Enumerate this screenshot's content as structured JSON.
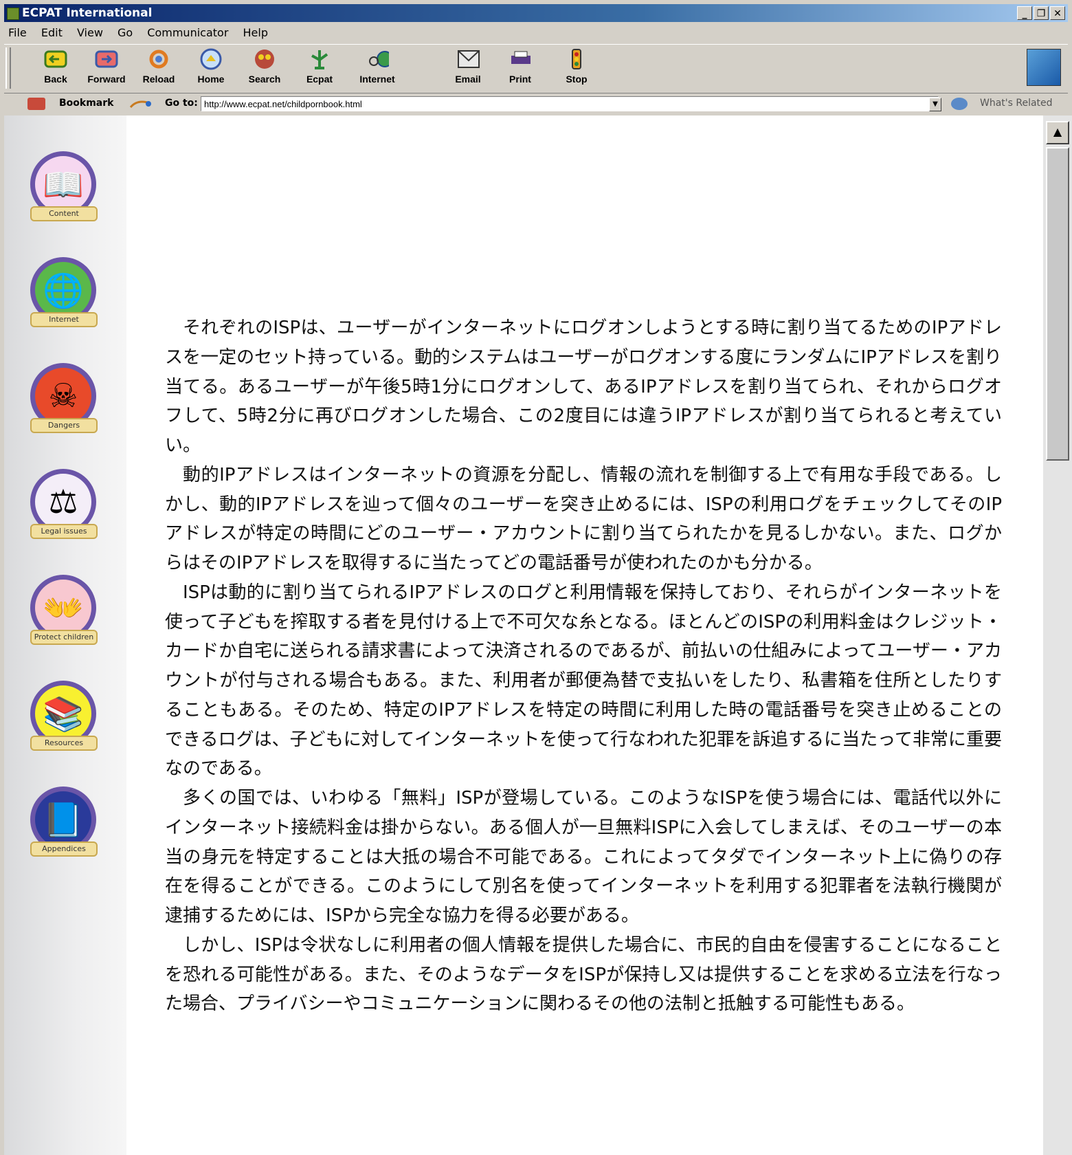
{
  "window": {
    "title": "ECPAT International",
    "controls": [
      "_",
      "❐",
      "✕"
    ]
  },
  "menu": [
    "File",
    "Edit",
    "View",
    "Go",
    "Communicator",
    "Help"
  ],
  "toolbar": {
    "buttons": [
      {
        "label": "Back",
        "icon": "back-arrow-icon"
      },
      {
        "label": "Forward",
        "icon": "forward-arrow-icon"
      },
      {
        "label": "Reload",
        "icon": "reload-icon"
      },
      {
        "label": "Home",
        "icon": "home-icon"
      },
      {
        "label": "Search",
        "icon": "search-icon"
      },
      {
        "label": "Ecpat",
        "icon": "ecpat-icon"
      },
      {
        "label": "Internet",
        "icon": "internet-icon"
      },
      {
        "label": "Email",
        "icon": "email-icon"
      },
      {
        "label": "Print",
        "icon": "print-icon"
      },
      {
        "label": "Stop",
        "icon": "stop-icon"
      }
    ]
  },
  "location": {
    "bookmark_label": "Bookmark",
    "goto_label": "Go to:",
    "url": "http://www.ecpat.net/childpornbook.html",
    "related_label": "What's Related"
  },
  "sidebar": {
    "items": [
      {
        "label": "Content",
        "icon": "book-icon"
      },
      {
        "label": "Internet",
        "icon": "globe-mouse-icon"
      },
      {
        "label": "Dangers",
        "icon": "skull-crossbones-icon"
      },
      {
        "label": "Legal issues",
        "icon": "scales-icon"
      },
      {
        "label": "Protect children",
        "icon": "hands-child-icon"
      },
      {
        "label": "Resources",
        "icon": "books-stack-icon"
      },
      {
        "label": "Appendices",
        "icon": "document-icon"
      }
    ]
  },
  "article": {
    "paragraphs": [
      "それぞれのISPは、ユーザーがインターネットにログオンしようとする時に割り当てるためのIPアドレスを一定のセット持っている。動的システムはユーザーがログオンする度にランダムにIPアドレスを割り当てる。あるユーザーが午後5時1分にログオンして、あるIPアドレスを割り当てられ、それからログオフして、5時2分に再びログオンした場合、この2度目には違うIPアドレスが割り当てられると考えていい。",
      "動的IPアドレスはインターネットの資源を分配し、情報の流れを制御する上で有用な手段である。しかし、動的IPアドレスを辿って個々のユーザーを突き止めるには、ISPの利用ログをチェックしてそのIPアドレスが特定の時間にどのユーザー・アカウントに割り当てられたかを見るしかない。また、ログからはそのIPアドレスを取得するに当たってどの電話番号が使われたのかも分かる。",
      "ISPは動的に割り当てられるIPアドレスのログと利用情報を保持しており、それらがインターネットを使って子どもを搾取する者を見付ける上で不可欠な糸となる。ほとんどのISPの利用料金はクレジット・カードか自宅に送られる請求書によって決済されるのであるが、前払いの仕組みによってユーザー・アカウントが付与される場合もある。また、利用者が郵便為替で支払いをしたり、私書箱を住所としたりすることもある。そのため、特定のIPアドレスを特定の時間に利用した時の電話番号を突き止めることのできるログは、子どもに対してインターネットを使って行なわれた犯罪を訴追するに当たって非常に重要なのである。",
      "多くの国では、いわゆる「無料」ISPが登場している。このようなISPを使う場合には、電話代以外にインターネット接続料金は掛からない。ある個人が一旦無料ISPに入会してしまえば、そのユーザーの本当の身元を特定することは大抵の場合不可能である。これによってタダでインターネット上に偽りの存在を得ることができる。このようにして別名を使ってインターネットを利用する犯罪者を法執行機関が逮捕するためには、ISPから完全な協力を得る必要がある。",
      "しかし、ISPは令状なしに利用者の個人情報を提供した場合に、市民的自由を侵害することになることを恐れる可能性がある。また、そのようなデータをISPが保持し又は提供することを求める立法を行なった場合、プライバシーやコミュニケーションに関わるその他の法制と抵触する可能性もある。"
    ]
  }
}
